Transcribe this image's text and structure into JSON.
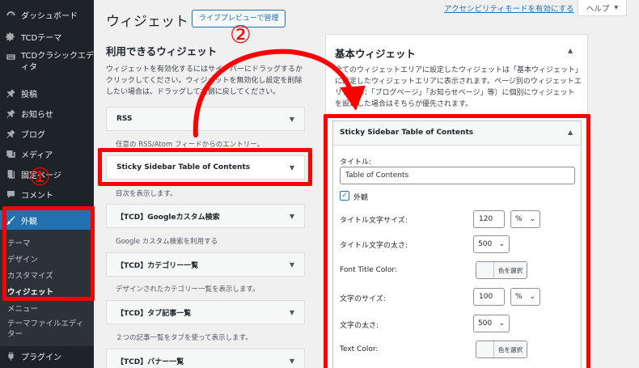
{
  "sidebar": {
    "items": [
      {
        "label": "ダッシュボード",
        "icon": "dashboard-icon"
      },
      {
        "label": "TCDテーマ",
        "icon": "gear-icon"
      },
      {
        "label": "TCDクラシックエディタ",
        "icon": "keyboard-icon"
      },
      {
        "label": "投稿",
        "icon": "pushpin-icon"
      },
      {
        "label": "お知らせ",
        "icon": "pushpin-icon"
      },
      {
        "label": "ブログ",
        "icon": "pushpin-icon"
      },
      {
        "label": "メディア",
        "icon": "media-icon"
      },
      {
        "label": "固定ページ",
        "icon": "page-icon"
      },
      {
        "label": "コメント",
        "icon": "comment-icon"
      },
      {
        "label": "外観",
        "icon": "paintbrush-icon"
      },
      {
        "label": "プラグイン",
        "icon": "plugin-icon"
      }
    ],
    "submenu": [
      "テーマ",
      "デザイン",
      "カスタマイズ",
      "ウィジェット",
      "メニュー",
      "テーマファイルエディター"
    ]
  },
  "header": {
    "title": "ウィジェット",
    "live_preview": "ライブプレビューで管理",
    "a11y_link": "アクセシビリティモードを有効にする",
    "help": "ヘルプ"
  },
  "available": {
    "title": "利用できるウィジェット",
    "description": "ウィジェットを有効化するにはサイドバーにドラッグするかクリックしてください。ウィジェットを無効化し設定を削除したい場合は、ドラッグして右側に戻してください。",
    "widgets": [
      {
        "name": "RSS",
        "desc": "任意の RSS/Atom フィードからのエントリー。"
      },
      {
        "name": "Sticky Sidebar Table of Contents",
        "desc": "目次を表示します。"
      },
      {
        "name": "【TCD】Googleカスタム検索",
        "desc": "Google カスタム検索を利用する"
      },
      {
        "name": "【TCD】カテゴリー一覧",
        "desc": "デザインされたカテゴリー一覧を表示します。"
      },
      {
        "name": "【TCD】タブ記事一覧",
        "desc": "２つの記事一覧をタブを使って表示します。"
      },
      {
        "name": "【TCD】バナー一覧",
        "desc": ""
      }
    ]
  },
  "area": {
    "title": "基本ウィジェット",
    "description": "全てのウィジェットエリアに設定したウィジェットは「基本ウィジェット」に設定したウィジェットエリアに表示されます。ページ別のウィジェットエリア（例：「ブログページ」「お知らせページ」等）に個別にウィジェットを設定した場合はそちらが優先されます。"
  },
  "form": {
    "widget_title": "Sticky Sidebar Table of Contents",
    "title_label": "タイトル:",
    "title_value": "Table of Contents",
    "outline_label": "外観",
    "title_size_label": "タイトル文字サイズ:",
    "title_size_value": "120",
    "title_size_unit": "%",
    "title_weight_label": "タイトル文字の太さ:",
    "title_weight_value": "500",
    "font_title_color_label": "Font Title Color:",
    "color_select": "色を選択",
    "font_size_label": "文字のサイズ:",
    "font_size_value": "100",
    "font_size_unit": "%",
    "font_weight_label": "文字の太さ:",
    "font_weight_value": "500",
    "text_color_label": "Text Color:"
  },
  "annotations": {
    "one": "①",
    "two": "②"
  },
  "colors": {
    "annotation": "#ff0000",
    "sidebar": "#1d2327",
    "accent": "#2271b1"
  }
}
